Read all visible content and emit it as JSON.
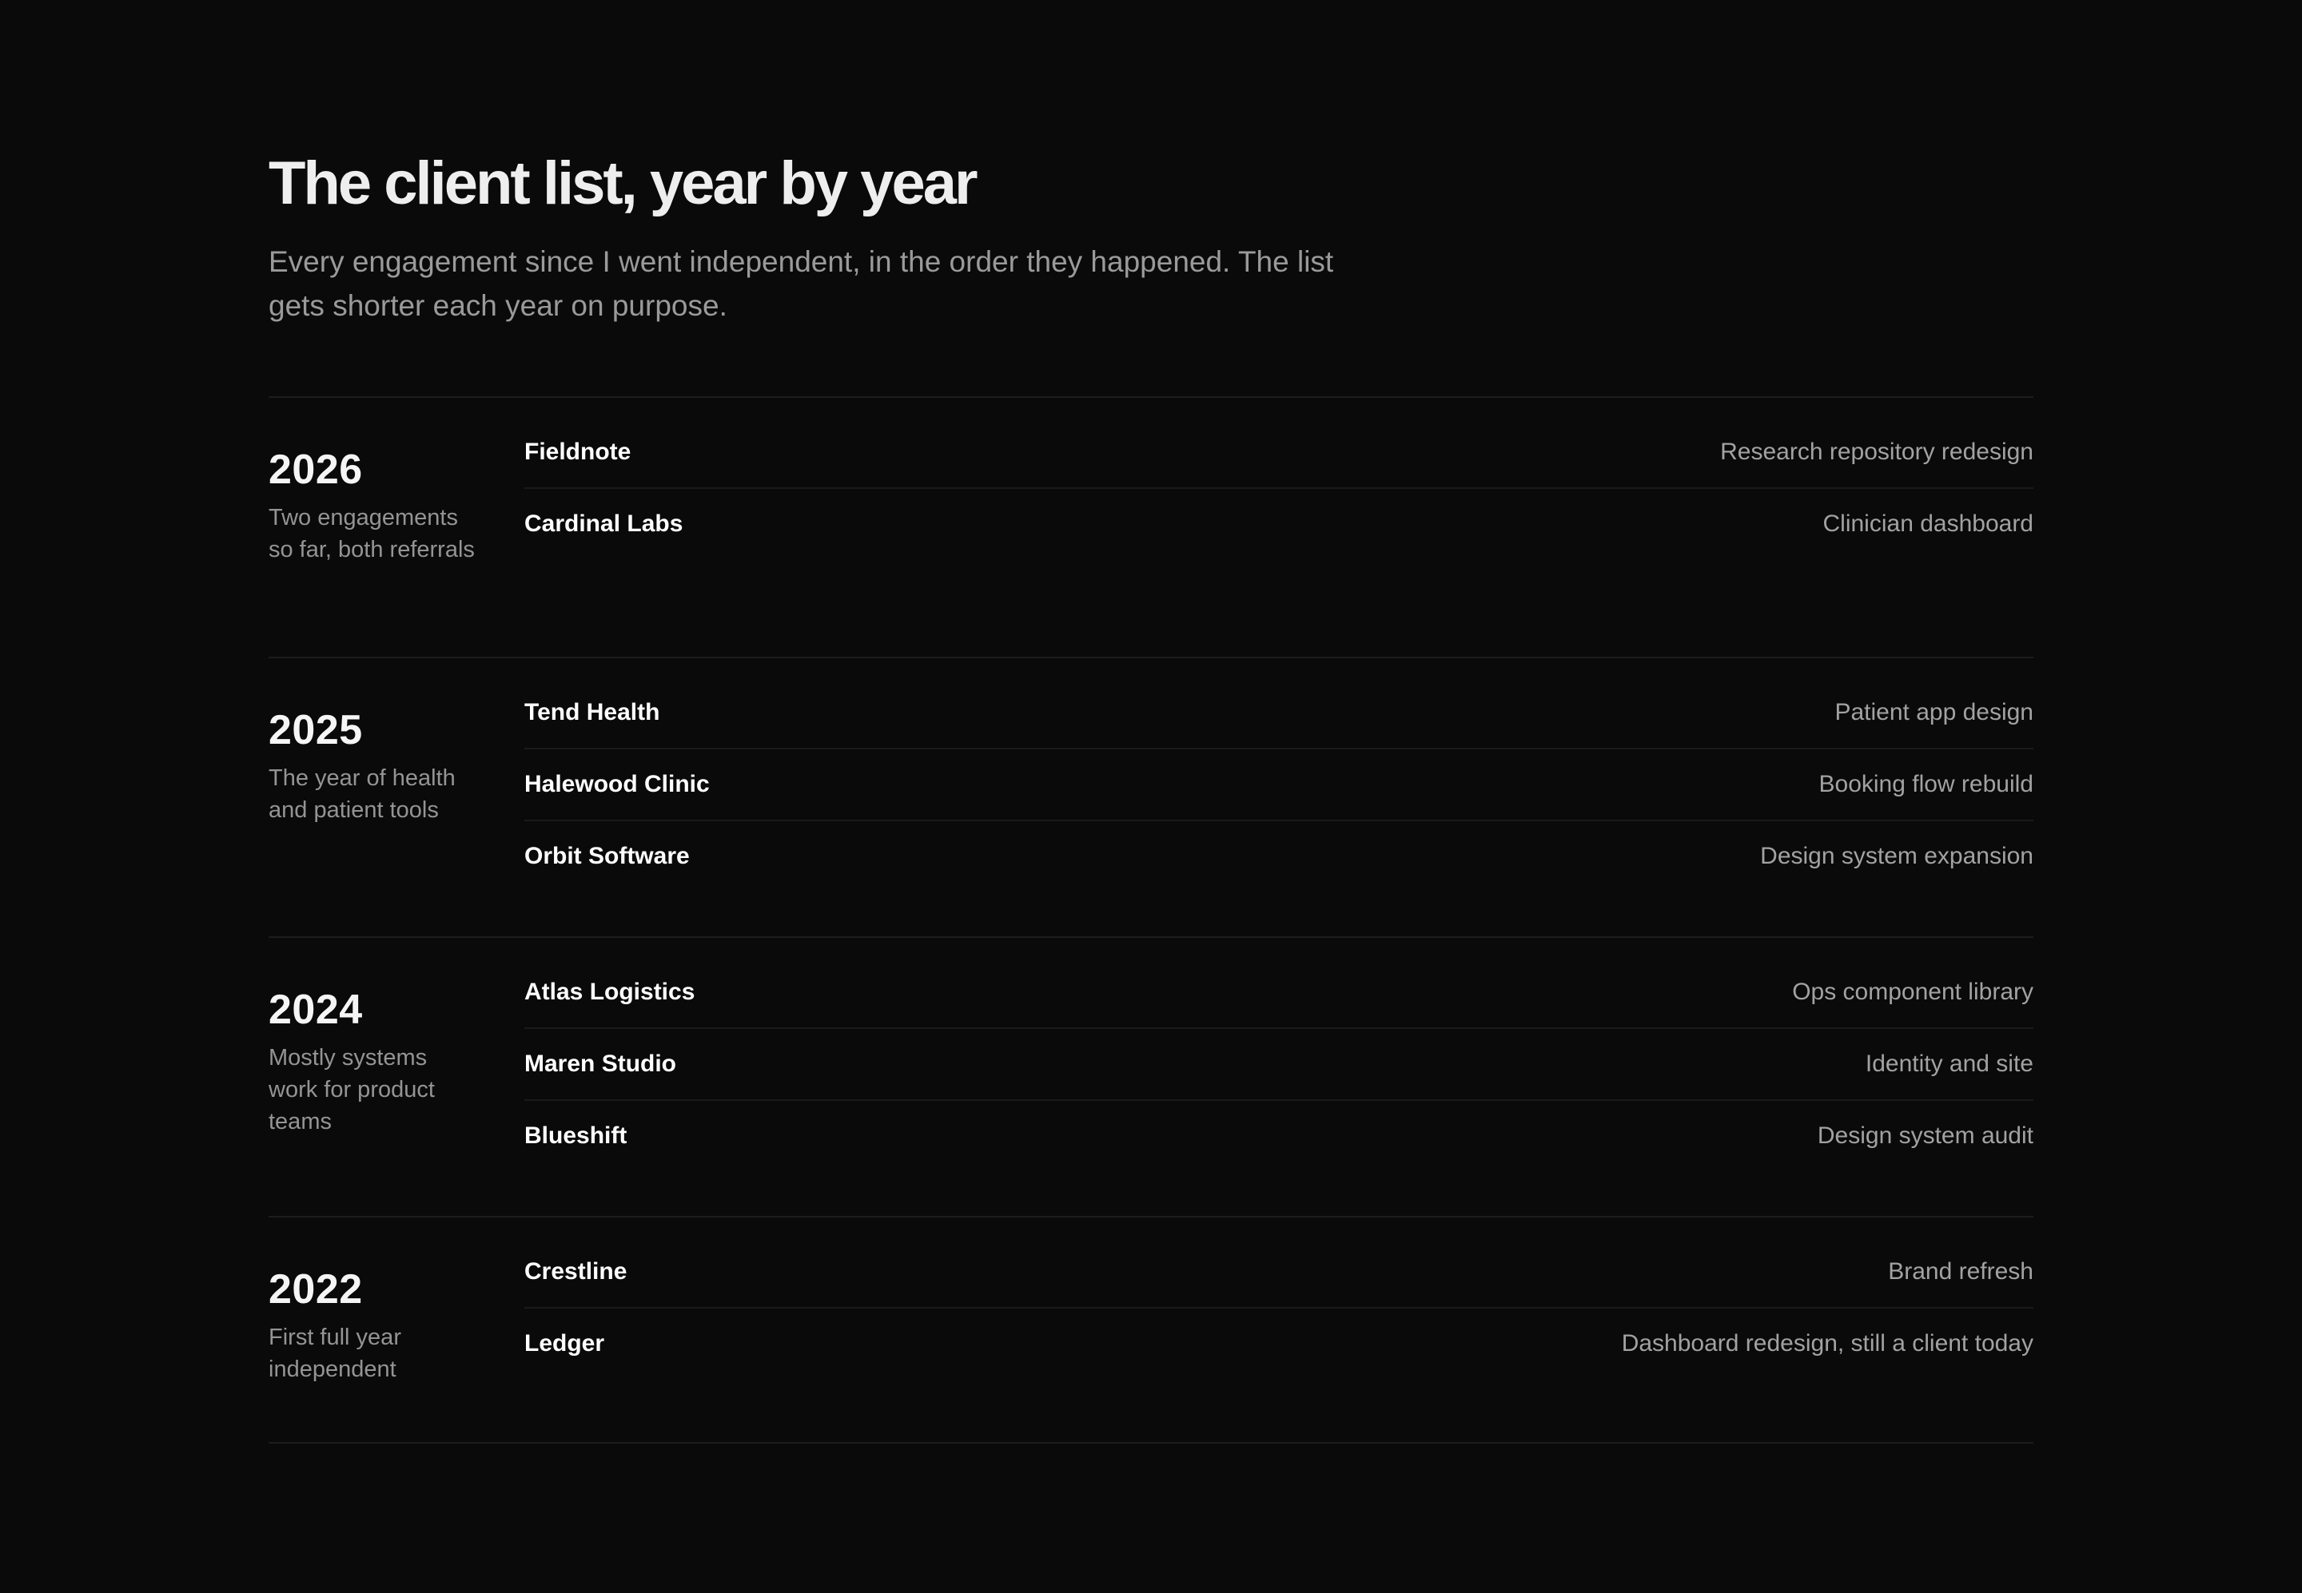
{
  "header": {
    "title": "The client list, year by year",
    "intro": "Every engagement since I went independent, in the order they happened. The list gets shorter each year on purpose."
  },
  "years": [
    {
      "year": "2026",
      "note": "Two engagements so far, both referrals",
      "engagements": [
        {
          "client": "Fieldnote",
          "description": "Research repository redesign"
        },
        {
          "client": "Cardinal Labs",
          "description": "Clinician dashboard"
        }
      ]
    },
    {
      "year": "2025",
      "note": "The year of health and patient tools",
      "engagements": [
        {
          "client": "Tend Health",
          "description": "Patient app design"
        },
        {
          "client": "Halewood Clinic",
          "description": "Booking flow rebuild"
        },
        {
          "client": "Orbit Software",
          "description": "Design system expansion"
        }
      ]
    },
    {
      "year": "2024",
      "note": "Mostly systems work for product teams",
      "engagements": [
        {
          "client": "Atlas Logistics",
          "description": "Ops component library"
        },
        {
          "client": "Maren Studio",
          "description": "Identity and site"
        },
        {
          "client": "Blueshift",
          "description": "Design system audit"
        }
      ]
    },
    {
      "year": "2022",
      "note": "First full year independent",
      "engagements": [
        {
          "client": "Crestline",
          "description": "Brand refresh"
        },
        {
          "client": "Ledger",
          "description": "Dashboard redesign, still a client today"
        }
      ]
    }
  ]
}
